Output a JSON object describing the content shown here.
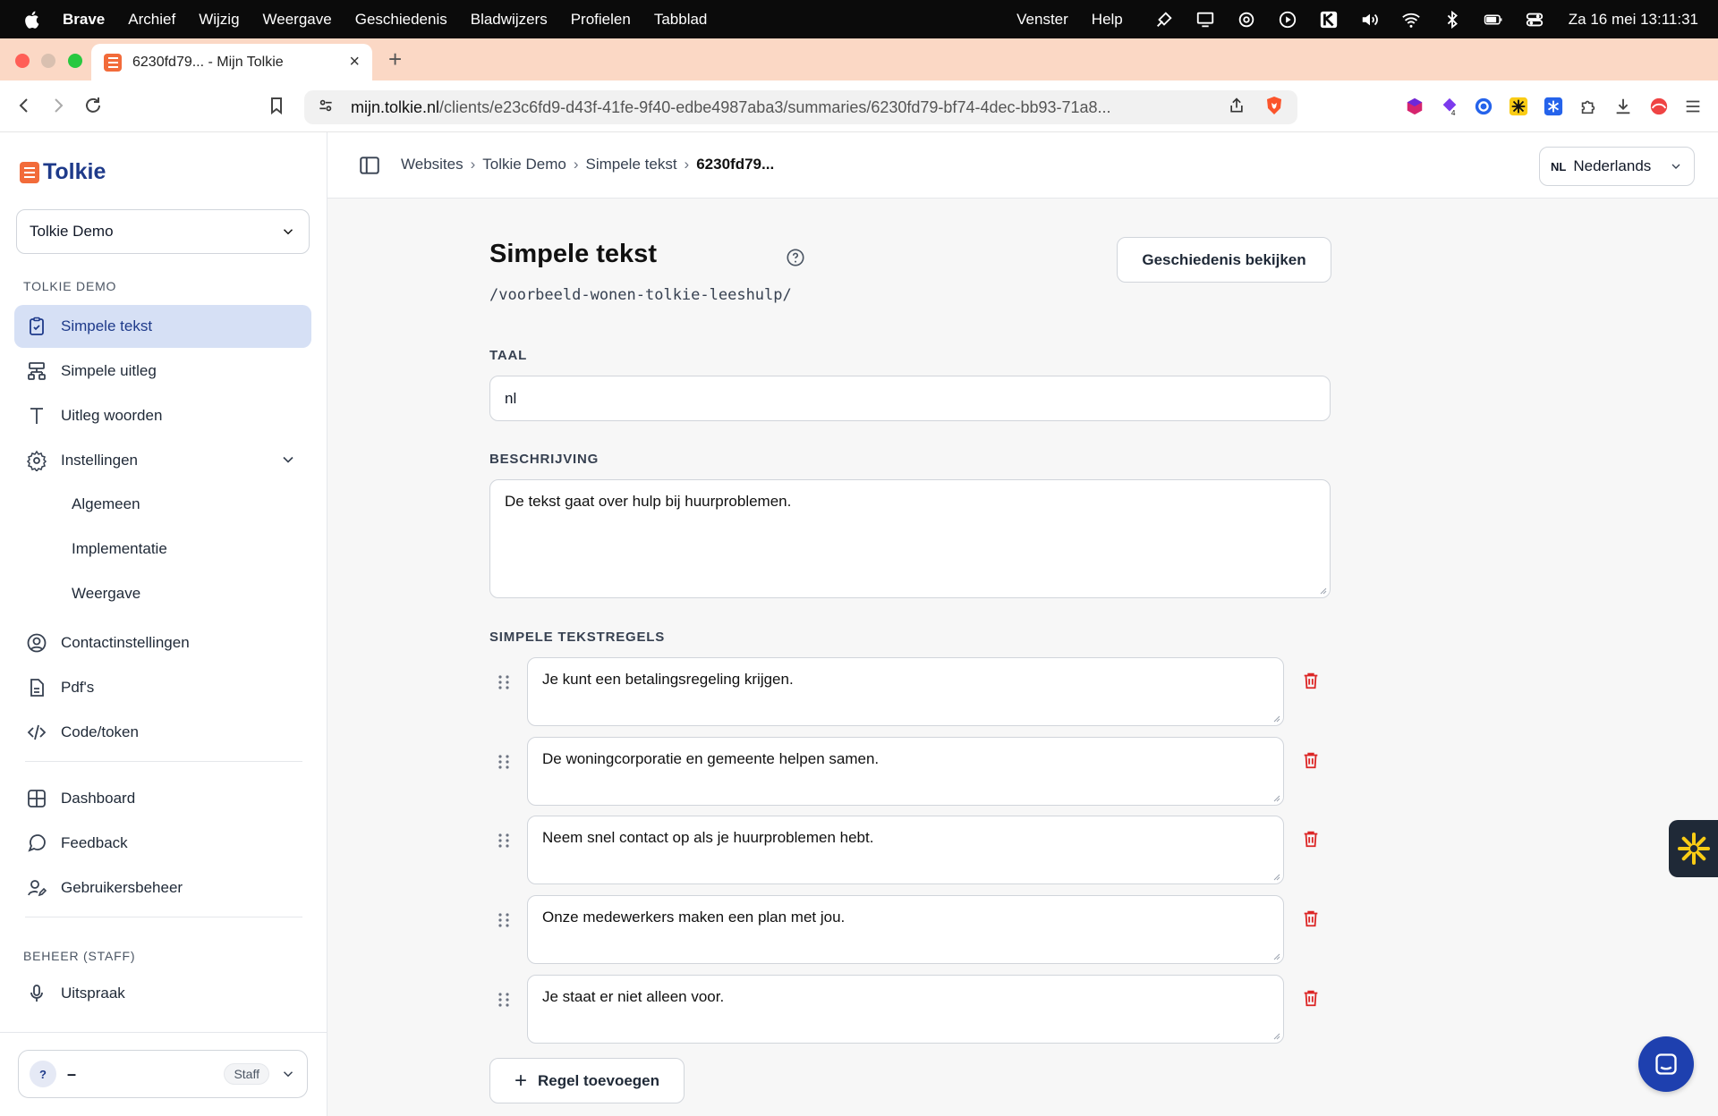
{
  "menubar": {
    "app": "Brave",
    "items": [
      "Archief",
      "Wijzig",
      "Weergave",
      "Geschiedenis",
      "Bladwijzers",
      "Profielen",
      "Tabblad"
    ],
    "right_items": [
      "Venster",
      "Help"
    ],
    "clock": "Za 16 mei  13:11:31"
  },
  "browser": {
    "tab_title": "6230fd79... - Mijn Tolkie",
    "url_host": "mijn.tolkie.nl",
    "url_path": "/clients/e23c6fd9-d43f-41fe-9f40-edbe4987aba3/summaries/6230fd79-bf74-4dec-bb93-71a8..."
  },
  "sidebar": {
    "logo": "Tolkie",
    "client": "Tolkie Demo",
    "section1": "TOLKIE DEMO",
    "items": [
      {
        "label": "Simpele tekst",
        "icon": "clipboard-check-icon"
      },
      {
        "label": "Simpele uitleg",
        "icon": "sitemap-icon"
      },
      {
        "label": "Uitleg woorden",
        "icon": "type-icon"
      },
      {
        "label": "Instellingen",
        "icon": "gear-icon"
      }
    ],
    "sub_items": [
      "Algemeen",
      "Implementatie",
      "Weergave"
    ],
    "items2": [
      {
        "label": "Contactinstellingen",
        "icon": "user-circle-icon"
      },
      {
        "label": "Pdf's",
        "icon": "file-icon"
      },
      {
        "label": "Code/token",
        "icon": "code-icon"
      }
    ],
    "items3": [
      {
        "label": "Dashboard",
        "icon": "grid-icon"
      },
      {
        "label": "Feedback",
        "icon": "chat-icon"
      },
      {
        "label": "Gebruikersbeheer",
        "icon": "user-edit-icon"
      }
    ],
    "section2": "BEHEER (STAFF)",
    "items4": [
      {
        "label": "Uitspraak",
        "icon": "microphone-icon"
      }
    ],
    "user": {
      "avatar": "?",
      "name": "–",
      "role": "Staff"
    }
  },
  "header": {
    "breadcrumb": [
      "Websites",
      "Tolkie Demo",
      "Simpele tekst"
    ],
    "current": "6230fd79...",
    "lang_code": "NL",
    "lang_name": "Nederlands"
  },
  "main": {
    "title": "Simpele tekst",
    "slug": "/voorbeeld-wonen-tolkie-leeshulp/",
    "history_button": "Geschiedenis bekijken",
    "taal_label": "TAAL",
    "taal_value": "nl",
    "beschrijving_label": "BESCHRIJVING",
    "beschrijving_value": "De tekst gaat over hulp bij huurproblemen.",
    "regels_label": "SIMPELE TEKSTREGELS",
    "regels": [
      "Je kunt een betalingsregeling krijgen.",
      "De woningcorporatie en gemeente helpen samen.",
      "Neem snel contact op als je huurproblemen hebt.",
      "Onze medewerkers maken een plan met jou.",
      "Je staat er niet alleen voor."
    ],
    "add_button": "Regel toevoegen"
  },
  "colors": {
    "accent": "#1e3a8a",
    "active_bg": "#d6e0f5",
    "brand_orange": "#f26b3a",
    "danger": "#dc2626"
  }
}
